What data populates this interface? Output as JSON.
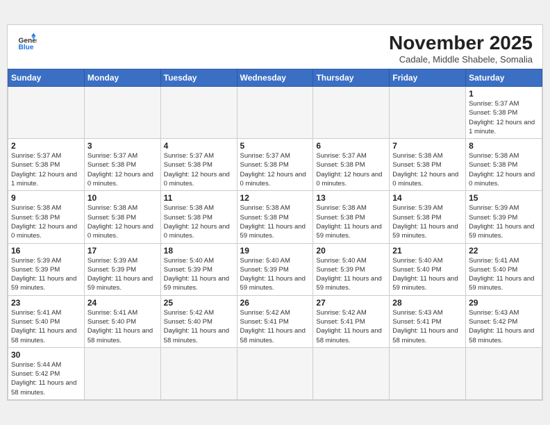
{
  "header": {
    "logo_line1": "General",
    "logo_line2": "Blue",
    "month": "November 2025",
    "location": "Cadale, Middle Shabele, Somalia"
  },
  "weekdays": [
    "Sunday",
    "Monday",
    "Tuesday",
    "Wednesday",
    "Thursday",
    "Friday",
    "Saturday"
  ],
  "weeks": [
    [
      {
        "day": "",
        "info": ""
      },
      {
        "day": "",
        "info": ""
      },
      {
        "day": "",
        "info": ""
      },
      {
        "day": "",
        "info": ""
      },
      {
        "day": "",
        "info": ""
      },
      {
        "day": "",
        "info": ""
      },
      {
        "day": "1",
        "info": "Sunrise: 5:37 AM\nSunset: 5:38 PM\nDaylight: 12 hours and 1 minute."
      }
    ],
    [
      {
        "day": "2",
        "info": "Sunrise: 5:37 AM\nSunset: 5:38 PM\nDaylight: 12 hours and 1 minute."
      },
      {
        "day": "3",
        "info": "Sunrise: 5:37 AM\nSunset: 5:38 PM\nDaylight: 12 hours and 0 minutes."
      },
      {
        "day": "4",
        "info": "Sunrise: 5:37 AM\nSunset: 5:38 PM\nDaylight: 12 hours and 0 minutes."
      },
      {
        "day": "5",
        "info": "Sunrise: 5:37 AM\nSunset: 5:38 PM\nDaylight: 12 hours and 0 minutes."
      },
      {
        "day": "6",
        "info": "Sunrise: 5:37 AM\nSunset: 5:38 PM\nDaylight: 12 hours and 0 minutes."
      },
      {
        "day": "7",
        "info": "Sunrise: 5:38 AM\nSunset: 5:38 PM\nDaylight: 12 hours and 0 minutes."
      },
      {
        "day": "8",
        "info": "Sunrise: 5:38 AM\nSunset: 5:38 PM\nDaylight: 12 hours and 0 minutes."
      }
    ],
    [
      {
        "day": "9",
        "info": "Sunrise: 5:38 AM\nSunset: 5:38 PM\nDaylight: 12 hours and 0 minutes."
      },
      {
        "day": "10",
        "info": "Sunrise: 5:38 AM\nSunset: 5:38 PM\nDaylight: 12 hours and 0 minutes."
      },
      {
        "day": "11",
        "info": "Sunrise: 5:38 AM\nSunset: 5:38 PM\nDaylight: 12 hours and 0 minutes."
      },
      {
        "day": "12",
        "info": "Sunrise: 5:38 AM\nSunset: 5:38 PM\nDaylight: 11 hours and 59 minutes."
      },
      {
        "day": "13",
        "info": "Sunrise: 5:38 AM\nSunset: 5:38 PM\nDaylight: 11 hours and 59 minutes."
      },
      {
        "day": "14",
        "info": "Sunrise: 5:39 AM\nSunset: 5:38 PM\nDaylight: 11 hours and 59 minutes."
      },
      {
        "day": "15",
        "info": "Sunrise: 5:39 AM\nSunset: 5:39 PM\nDaylight: 11 hours and 59 minutes."
      }
    ],
    [
      {
        "day": "16",
        "info": "Sunrise: 5:39 AM\nSunset: 5:39 PM\nDaylight: 11 hours and 59 minutes."
      },
      {
        "day": "17",
        "info": "Sunrise: 5:39 AM\nSunset: 5:39 PM\nDaylight: 11 hours and 59 minutes."
      },
      {
        "day": "18",
        "info": "Sunrise: 5:40 AM\nSunset: 5:39 PM\nDaylight: 11 hours and 59 minutes."
      },
      {
        "day": "19",
        "info": "Sunrise: 5:40 AM\nSunset: 5:39 PM\nDaylight: 11 hours and 59 minutes."
      },
      {
        "day": "20",
        "info": "Sunrise: 5:40 AM\nSunset: 5:39 PM\nDaylight: 11 hours and 59 minutes."
      },
      {
        "day": "21",
        "info": "Sunrise: 5:40 AM\nSunset: 5:40 PM\nDaylight: 11 hours and 59 minutes."
      },
      {
        "day": "22",
        "info": "Sunrise: 5:41 AM\nSunset: 5:40 PM\nDaylight: 11 hours and 59 minutes."
      }
    ],
    [
      {
        "day": "23",
        "info": "Sunrise: 5:41 AM\nSunset: 5:40 PM\nDaylight: 11 hours and 58 minutes."
      },
      {
        "day": "24",
        "info": "Sunrise: 5:41 AM\nSunset: 5:40 PM\nDaylight: 11 hours and 58 minutes."
      },
      {
        "day": "25",
        "info": "Sunrise: 5:42 AM\nSunset: 5:40 PM\nDaylight: 11 hours and 58 minutes."
      },
      {
        "day": "26",
        "info": "Sunrise: 5:42 AM\nSunset: 5:41 PM\nDaylight: 11 hours and 58 minutes."
      },
      {
        "day": "27",
        "info": "Sunrise: 5:42 AM\nSunset: 5:41 PM\nDaylight: 11 hours and 58 minutes."
      },
      {
        "day": "28",
        "info": "Sunrise: 5:43 AM\nSunset: 5:41 PM\nDaylight: 11 hours and 58 minutes."
      },
      {
        "day": "29",
        "info": "Sunrise: 5:43 AM\nSunset: 5:42 PM\nDaylight: 11 hours and 58 minutes."
      }
    ],
    [
      {
        "day": "30",
        "info": "Sunrise: 5:44 AM\nSunset: 5:42 PM\nDaylight: 11 hours and 58 minutes."
      },
      {
        "day": "",
        "info": ""
      },
      {
        "day": "",
        "info": ""
      },
      {
        "day": "",
        "info": ""
      },
      {
        "day": "",
        "info": ""
      },
      {
        "day": "",
        "info": ""
      },
      {
        "day": "",
        "info": ""
      }
    ]
  ]
}
